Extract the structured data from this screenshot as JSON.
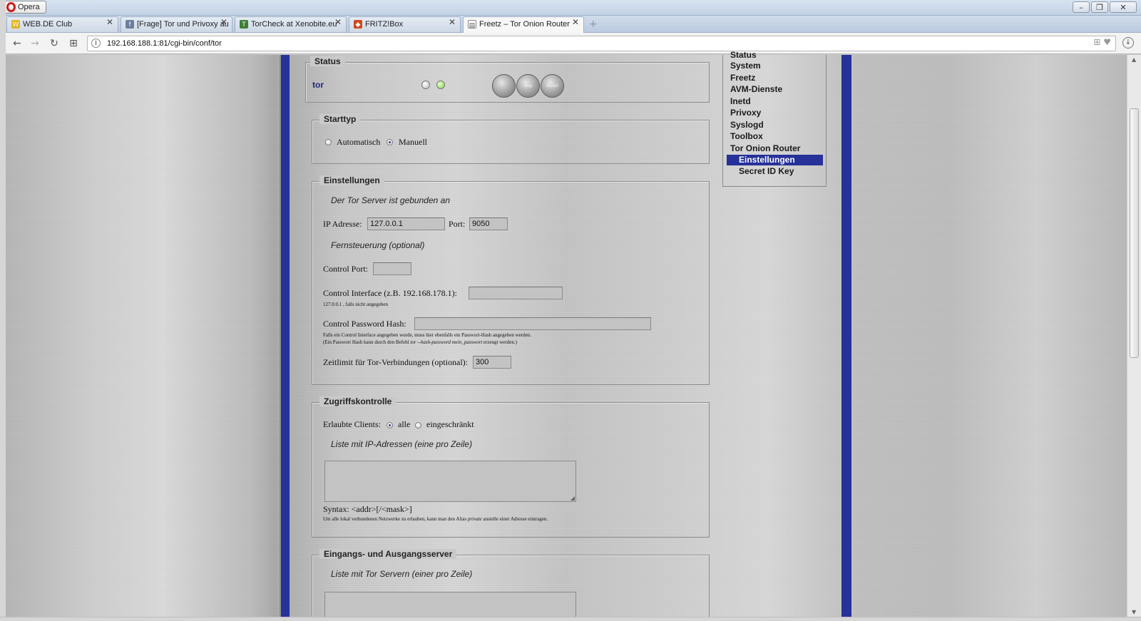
{
  "browser": {
    "app_button": "Opera",
    "tabs": [
      {
        "title": "WEB.DE Club",
        "active": false
      },
      {
        "title": "[Frage] Tor und Privoxy au",
        "active": false
      },
      {
        "title": "TorCheck at Xenobite.eu",
        "active": false
      },
      {
        "title": "FRITZ!Box",
        "active": false
      },
      {
        "title": "Freetz – Tor Onion Router",
        "active": true
      }
    ],
    "url": "192.168.188.1:81/cgi-bin/conf/tor"
  },
  "status": {
    "legend": "Status",
    "service_name": "tor",
    "led_off_color": "#dedede",
    "led_on_color": "#7fd23c",
    "buttons": [
      "",
      "stop",
      "restart"
    ]
  },
  "starttyp": {
    "legend": "Starttyp",
    "options": [
      "Automatisch",
      "Manuell"
    ],
    "selected": "Manuell"
  },
  "einstellungen": {
    "legend": "Einstellungen",
    "bound_note": "Der Tor Server ist gebunden an",
    "ip_label": "IP Adresse:",
    "ip_value": "127.0.0.1",
    "port_label": "Port:",
    "port_value": "9050",
    "remote_note": "Fernsteuerung (optional)",
    "control_port_label": "Control Port:",
    "control_port_value": "",
    "control_interface_label": "Control Interface (z.B. 192.168.178.1):",
    "control_interface_value": "",
    "control_interface_hint": "127.0.0.1 , falls nicht angegeben",
    "password_hash_label": "Control Password Hash:",
    "password_hash_value": "",
    "password_hint_1": "Falls ein Control Interface angegeben wurde, muss hier ebenfalls ein Passwort-Hash angegeben werden.",
    "password_hint_2a": "(Ein Passwort Hash kann durch den Befehl ",
    "password_hint_2b": "tor --hash-password mein_passwort",
    "password_hint_2c": " erzeugt werden.)",
    "timeout_label": "Zeitlimit für Tor-Verbindungen (optional):",
    "timeout_value": "300"
  },
  "zugriff": {
    "legend": "Zugriffskontrolle",
    "clients_label": "Erlaubte Clients:",
    "options": [
      "alle",
      "eingeschränkt"
    ],
    "selected": "alle",
    "list_note": "Liste mit IP-Adressen (eine pro Zeile)",
    "syntax": "Syntax: <addr>[/<mask>]",
    "hint_a": "Um alle lokal verbundenen Netzwerke zu erlauben, kann man den Alias ",
    "hint_b": "private",
    "hint_c": " anstelle einer Adresse eintragen."
  },
  "server": {
    "legend": "Eingangs- und Ausgangsserver",
    "list_note": "Liste mit Tor Servern (einer pro Zeile)"
  },
  "menu": {
    "items": [
      {
        "label": "Status",
        "sub": false,
        "active": false
      },
      {
        "label": "System",
        "sub": false,
        "active": false
      },
      {
        "label": "Freetz",
        "sub": false,
        "active": false
      },
      {
        "label": "AVM-Dienste",
        "sub": false,
        "active": false
      },
      {
        "label": "Inetd",
        "sub": false,
        "active": false
      },
      {
        "label": "Privoxy",
        "sub": false,
        "active": false
      },
      {
        "label": "Syslogd",
        "sub": false,
        "active": false
      },
      {
        "label": "Toolbox",
        "sub": false,
        "active": false
      },
      {
        "label": "Tor Onion Router",
        "sub": false,
        "active": false
      },
      {
        "label": "Einstellungen",
        "sub": true,
        "active": true
      },
      {
        "label": "Secret ID Key",
        "sub": true,
        "active": false
      }
    ]
  },
  "colors": {
    "pillar_blue": "#26319a",
    "menu_active_bg": "#26319a"
  }
}
